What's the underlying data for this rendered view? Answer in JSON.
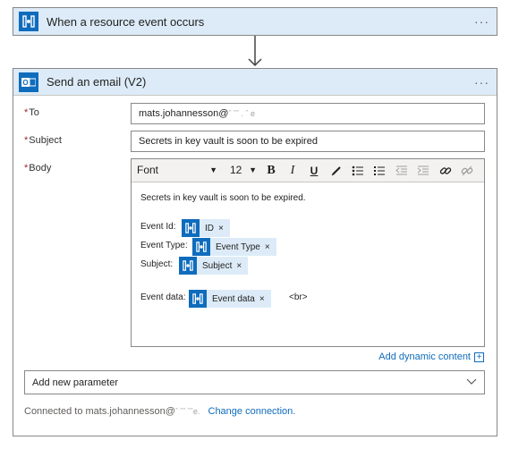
{
  "trigger": {
    "title": "When a resource event occurs",
    "more": "···",
    "icon": "event-grid-icon"
  },
  "action": {
    "title": "Send an email (V2)",
    "more": "···",
    "icon": "outlook-icon",
    "fields": {
      "to": {
        "required": "*",
        "label": "To",
        "value": "mats.johannesson@",
        "redacted": "ˆ ˇˇ .   ˆ e"
      },
      "subject": {
        "required": "*",
        "label": "Subject",
        "value": "Secrets in key vault is soon to be expired"
      },
      "body": {
        "required": "*",
        "label": "Body"
      }
    },
    "toolbar": {
      "font": "Font",
      "size": "12",
      "bold": "B",
      "italic": "I",
      "underline": "U"
    },
    "body": {
      "intro": "Secrets in key vault is soon to be expired.",
      "event_id_label": "Event Id:",
      "event_type_label": "Event Type:",
      "subject_label": "Subject:",
      "event_data_label": "Event data:",
      "br": "<br>",
      "tokens": {
        "id": "ID",
        "event_type": "Event Type",
        "subject": "Subject",
        "event_data": "Event data"
      },
      "remove": "×"
    },
    "dynamic_content": "Add dynamic content",
    "dynamic_plus": "+",
    "add_parameter": "Add new parameter",
    "connection": {
      "prefix": "Connected to mats.johannesson@",
      "redacted": "ˆ  ˆˆ  ˆˆe.",
      "change": "Change connection."
    }
  },
  "colors": {
    "header_bg": "#dcebf7",
    "accent": "#0f6cbd",
    "required": "#a4262c"
  }
}
